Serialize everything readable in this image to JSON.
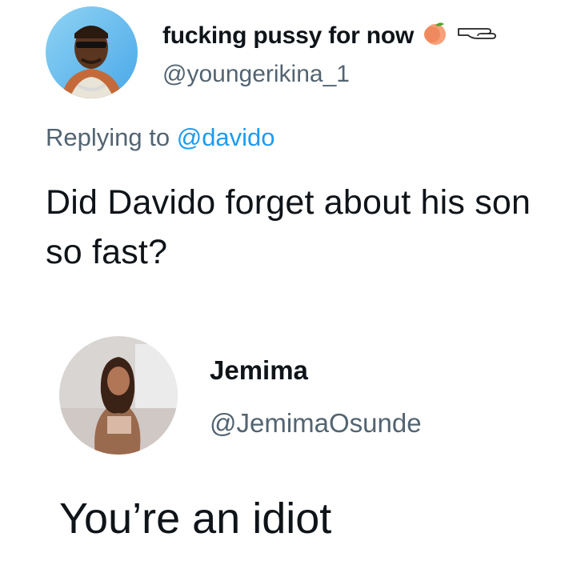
{
  "tweet_original": {
    "display_name": "fucking pussy for now",
    "handle": "@youngerikina_1",
    "replying_to_label": "Replying to",
    "replying_to_handle": "@davido",
    "text": "Did Davido forget about his son so fast?",
    "name_emojis": [
      "peach-icon",
      "pointing-hand-icon"
    ]
  },
  "tweet_reply": {
    "display_name": "Jemima",
    "handle": "@JemimaOsunde",
    "text": "You’re an idiot"
  },
  "colors": {
    "text": "#0f1419",
    "secondary": "#536471",
    "link": "#1d9bf0",
    "background": "#ffffff"
  }
}
